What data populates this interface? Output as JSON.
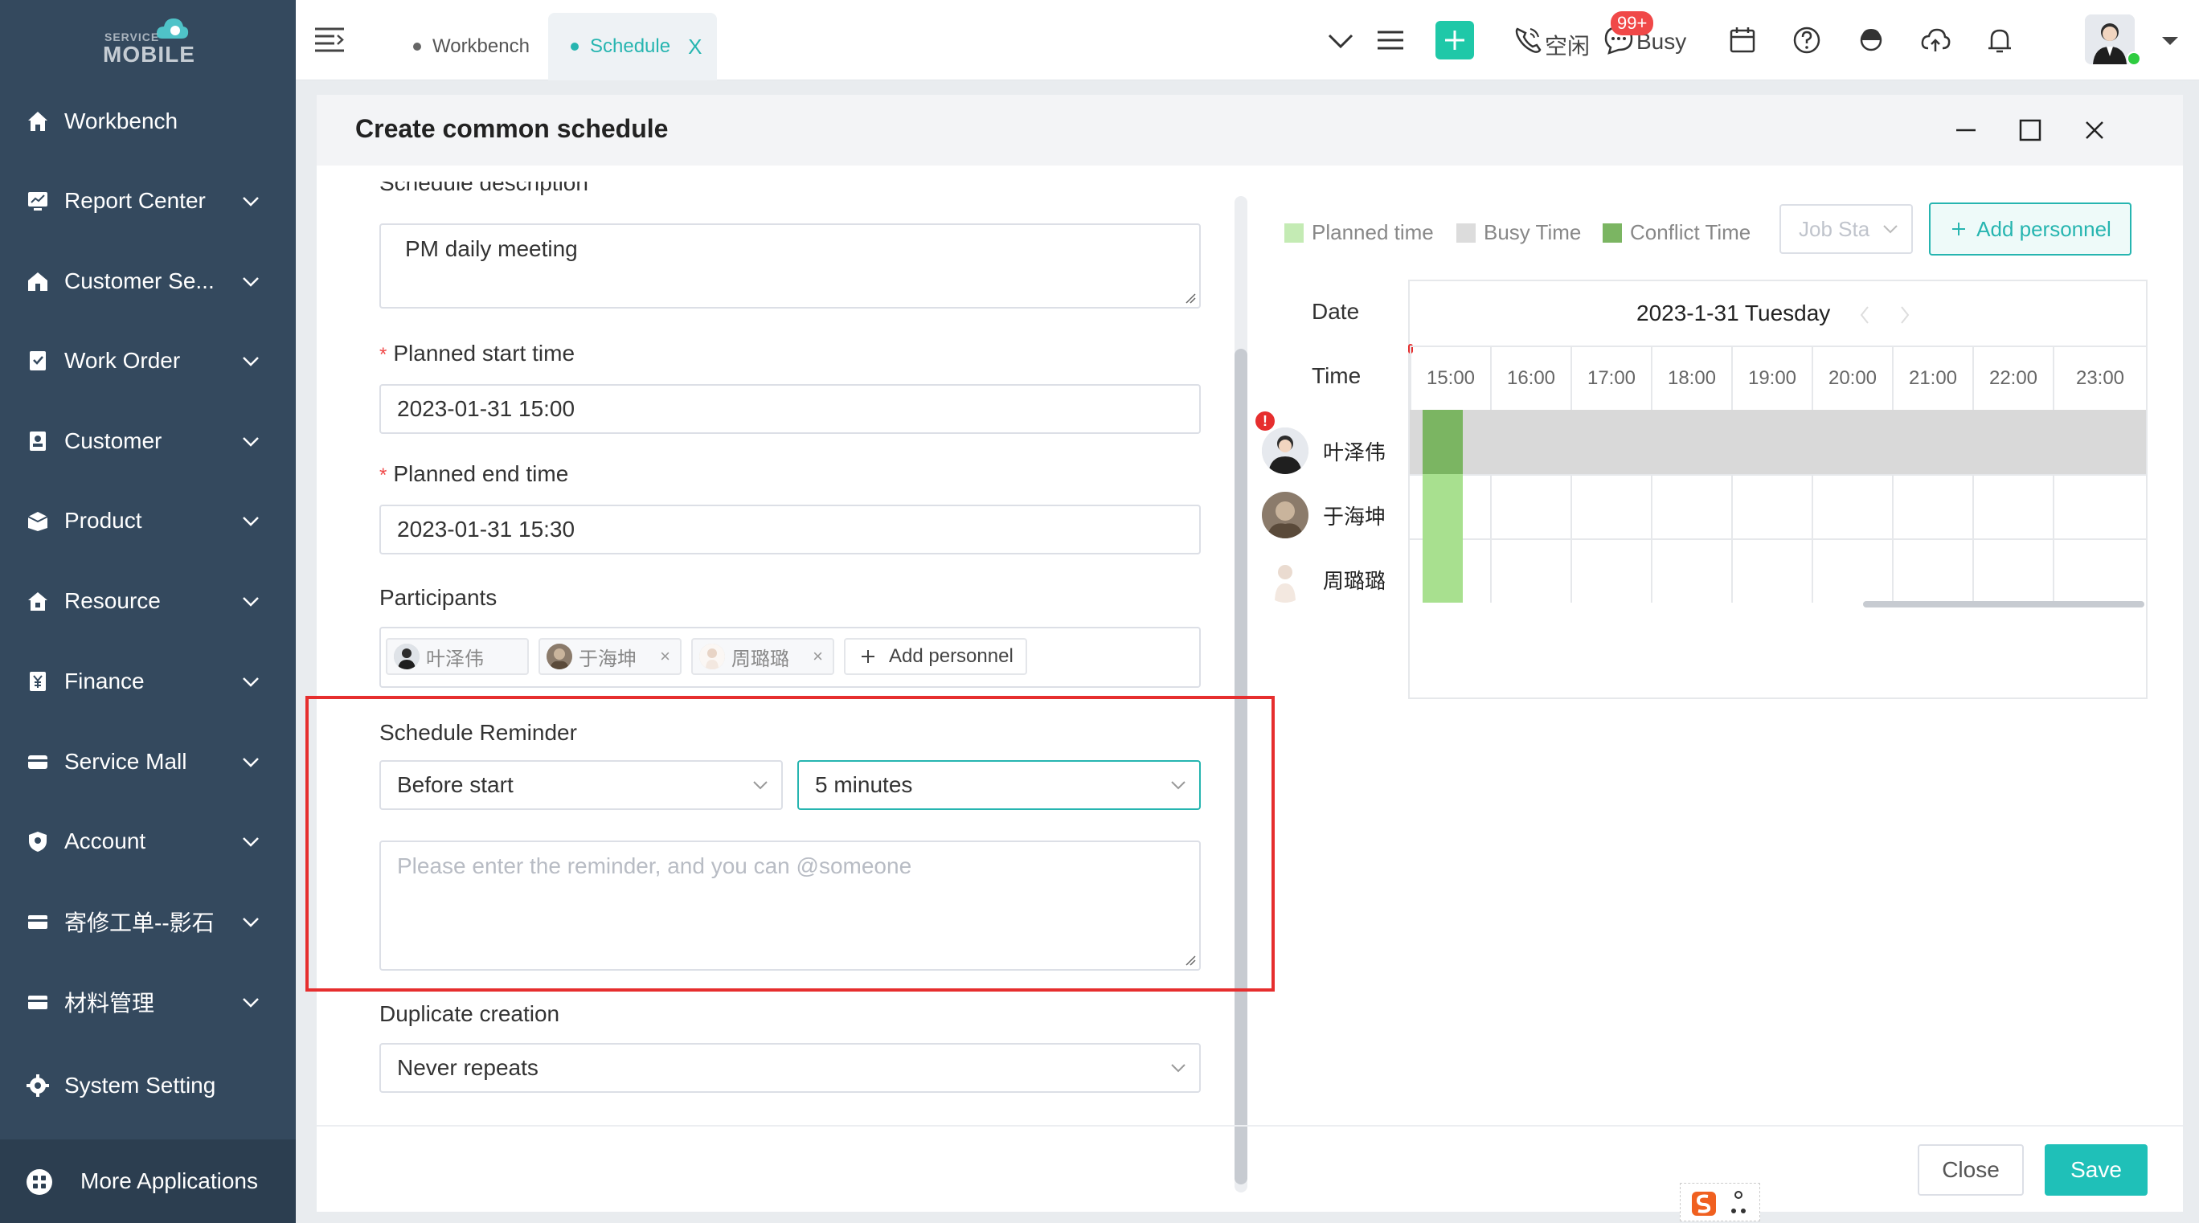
{
  "app": {
    "logo_small": "SERVICE",
    "logo_big": "MOBILE"
  },
  "sidebar": {
    "items": [
      {
        "label": "Workbench",
        "icon": "home-icon",
        "expandable": false
      },
      {
        "label": "Report Center",
        "icon": "report-icon",
        "expandable": true
      },
      {
        "label": "Customer Se...",
        "icon": "customer-service-icon",
        "expandable": true
      },
      {
        "label": "Work Order",
        "icon": "work-order-icon",
        "expandable": true
      },
      {
        "label": "Customer",
        "icon": "customer-icon",
        "expandable": true
      },
      {
        "label": "Product",
        "icon": "product-icon",
        "expandable": true
      },
      {
        "label": "Resource",
        "icon": "resource-icon",
        "expandable": true
      },
      {
        "label": "Finance",
        "icon": "finance-icon",
        "expandable": true
      },
      {
        "label": "Service Mall",
        "icon": "mall-icon",
        "expandable": true
      },
      {
        "label": "Account",
        "icon": "account-icon",
        "expandable": true
      },
      {
        "label": "寄修工单--影石",
        "icon": "mail-repair-icon",
        "expandable": true
      },
      {
        "label": "材料管理",
        "icon": "materials-icon",
        "expandable": true
      },
      {
        "label": "System Setting",
        "icon": "gear-icon",
        "expandable": false
      }
    ],
    "more_apps": "More Applications"
  },
  "topbar": {
    "tabs": [
      {
        "label": "Workbench",
        "active": false
      },
      {
        "label": "Schedule",
        "active": true,
        "close": "X"
      }
    ],
    "status_idle": "空闲",
    "status_busy": "Busy",
    "badge": "99+"
  },
  "dialog": {
    "title": "Create common schedule",
    "form": {
      "description_label": "Schedule description",
      "description_value": "PM daily meeting",
      "start_label": "Planned start time",
      "start_value": "2023-01-31 15:00",
      "end_label": "Planned end time",
      "end_value": "2023-01-31 15:30",
      "participants_label": "Participants",
      "participants": [
        {
          "name": "叶泽伟"
        },
        {
          "name": "于海坤"
        },
        {
          "name": "周璐璐"
        }
      ],
      "chip_remove": "×",
      "add_personnel": "Add personnel",
      "reminder_label": "Schedule Reminder",
      "reminder_when": "Before start",
      "reminder_offset": "5 minutes",
      "reminder_placeholder": "Please enter the reminder, and you can @someone",
      "duplicate_label": "Duplicate creation",
      "duplicate_value": "Never repeats"
    },
    "schedule": {
      "legend": [
        {
          "label": "Planned time",
          "color": "#a8e08f"
        },
        {
          "label": "Busy Time",
          "color": "#dcdcdc"
        },
        {
          "label": "Conflict Time",
          "color": "#7bb562"
        }
      ],
      "job_status_placeholder": "Job Sta",
      "add_personnel": "Add personnel",
      "date_header": "Date",
      "time_header": "Time",
      "date_value": "2023-1-31 Tuesday",
      "times": [
        "15:00",
        "16:00",
        "17:00",
        "18:00",
        "19:00",
        "20:00",
        "21:00",
        "22:00",
        "23:00"
      ],
      "people": [
        {
          "name": "叶泽伟",
          "alert": "!"
        },
        {
          "name": "于海坤"
        },
        {
          "name": "周璐璐"
        }
      ]
    },
    "buttons": {
      "close": "Close",
      "save": "Save"
    }
  }
}
